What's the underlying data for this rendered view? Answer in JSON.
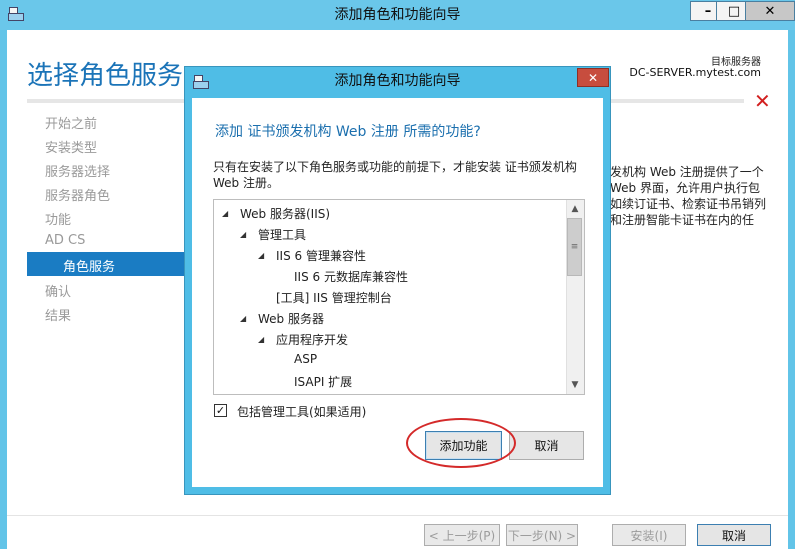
{
  "window": {
    "title": "添加角色和功能向导",
    "minimize": "–",
    "maximize": "□",
    "close": "✕"
  },
  "wizard": {
    "page_title": "选择角色服务",
    "target_server_label": "目标服务器",
    "target_server_value": "DC-SERVER.mytest.com",
    "nav": [
      "开始之前",
      "安装类型",
      "服务器选择",
      "服务器角色",
      "功能",
      "AD CS",
      "角色服务",
      "确认",
      "结果"
    ],
    "nav_active": "角色服务",
    "description_lines": [
      "发机构 Web 注册提供了一个",
      "Web 界面，允许用户执行包",
      "如续订证书、检索证书吊销列",
      "和注册智能卡证书在内的任"
    ],
    "buttons": {
      "previous": "< 上一步(P)",
      "next": "下一步(N) >",
      "install": "安装(I)",
      "cancel": "取消"
    }
  },
  "dialog": {
    "title": "添加角色和功能向导",
    "close": "✕",
    "heading": "添加 证书颁发机构 Web 注册 所需的功能?",
    "paragraph_lines": [
      "只有在安装了以下角色服务或功能的前提下，才能安装 证书颁发机构",
      "Web 注册。"
    ],
    "tree": [
      "Web 服务器(IIS)",
      "管理工具",
      "IIS 6 管理兼容性",
      "IIS 6 元数据库兼容性",
      "[工具] IIS 管理控制台",
      "Web 服务器",
      "应用程序开发",
      "ASP",
      "ISAPI 扩展"
    ],
    "include_tools_checked": true,
    "include_tools_label": "包括管理工具(如果适用)",
    "add_features_button": "添加功能",
    "cancel_button": "取消"
  },
  "colors": {
    "title_bar": "#6ac7ea",
    "accent_blue": "#1b74b8",
    "nav_active_bg": "#1a7cc3",
    "highlight_red": "#d42a2a"
  }
}
